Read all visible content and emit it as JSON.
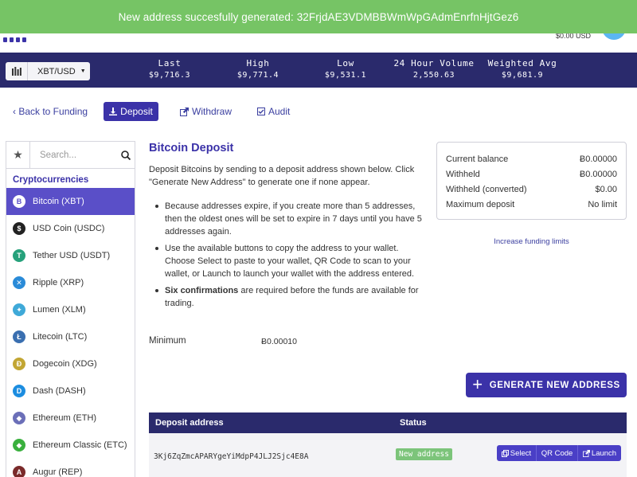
{
  "toast": {
    "message": "New address succesfully generated: 32FrjdAE3VDMBBWmWpGAdmEnrfnHjtGez6"
  },
  "header": {
    "balance_usd": "$0.00 USD"
  },
  "ticker": {
    "pair": "XBT/USD",
    "stats": [
      {
        "label": "Last",
        "value": "$9,716.3"
      },
      {
        "label": "High",
        "value": "$9,771.4"
      },
      {
        "label": "Low",
        "value": "$9,531.1"
      },
      {
        "label": "24 Hour Volume",
        "value": "2,550.63"
      },
      {
        "label": "Weighted Avg",
        "value": "$9,681.9"
      }
    ]
  },
  "subnav": {
    "back": "‹ Back to Funding",
    "deposit": "Deposit",
    "withdraw": "Withdraw",
    "audit": "Audit"
  },
  "sidebar": {
    "search_placeholder": "Search...",
    "heading": "Cryptocurrencies",
    "coins": [
      {
        "label": "Bitcoin (XBT)",
        "glyph": "B",
        "color": "#f7931a"
      },
      {
        "label": "USD Coin (USDC)",
        "glyph": "$",
        "color": "#222222"
      },
      {
        "label": "Tether USD (USDT)",
        "glyph": "T",
        "color": "#26a17b"
      },
      {
        "label": "Ripple (XRP)",
        "glyph": "✕",
        "color": "#2a8bd8"
      },
      {
        "label": "Lumen (XLM)",
        "glyph": "✦",
        "color": "#3fa9d8"
      },
      {
        "label": "Litecoin (LTC)",
        "glyph": "Ł",
        "color": "#3a6fb0"
      },
      {
        "label": "Dogecoin (XDG)",
        "glyph": "Ð",
        "color": "#c2a633"
      },
      {
        "label": "Dash (DASH)",
        "glyph": "D",
        "color": "#1c8de0"
      },
      {
        "label": "Ethereum (ETH)",
        "glyph": "◆",
        "color": "#6b6fb8"
      },
      {
        "label": "Ethereum Classic (ETC)",
        "glyph": "◆",
        "color": "#3ab03e"
      },
      {
        "label": "Augur (REP)",
        "glyph": "A",
        "color": "#7a2a2a"
      }
    ]
  },
  "main": {
    "title": "Bitcoin Deposit",
    "intro": "Deposit Bitcoins by sending to a deposit address shown below. Click \"Generate New Address\" to generate one if none appear.",
    "bullet_1": "Because addresses expire, if you create more than 5 addresses, then the oldest ones will be set to expire in 7 days until you have 5 addresses again.",
    "bullet_2": "Use the available buttons to copy the address to your wallet. Choose Select to paste to your wallet, QR Code to scan to your wallet, or Launch to launch your wallet with the address entered.",
    "bullet_3_bold": "Six confirmations",
    "bullet_3_rest": " are required before the funds are available for trading.",
    "minimum_label": "Minimum",
    "minimum_value": "Ƀ0.00010",
    "generate_button": "GENERATE NEW ADDRESS"
  },
  "balance": {
    "rows": [
      {
        "label": "Current balance",
        "value": "Ƀ0.00000"
      },
      {
        "label": "Withheld",
        "value": "Ƀ0.00000"
      },
      {
        "label": "Withheld (converted)",
        "value": "$0.00"
      },
      {
        "label": "Maximum deposit",
        "value": "No limit"
      }
    ],
    "increase_link": "Increase funding limits"
  },
  "table": {
    "headers": {
      "address": "Deposit address",
      "status": "Status"
    },
    "rows": [
      {
        "address": "3Kj6ZqZmcAPARYgeYiMdpP4JLJ2Sjc4E8A",
        "status": "New address"
      }
    ],
    "actions": {
      "select": "Select",
      "qr": "QR Code",
      "launch": "Launch"
    }
  },
  "colors": {
    "accent": "#3b32a8",
    "ticker_bg": "#2a2a6c",
    "toast_bg": "#76c465",
    "status_green": "#7cc47a"
  }
}
